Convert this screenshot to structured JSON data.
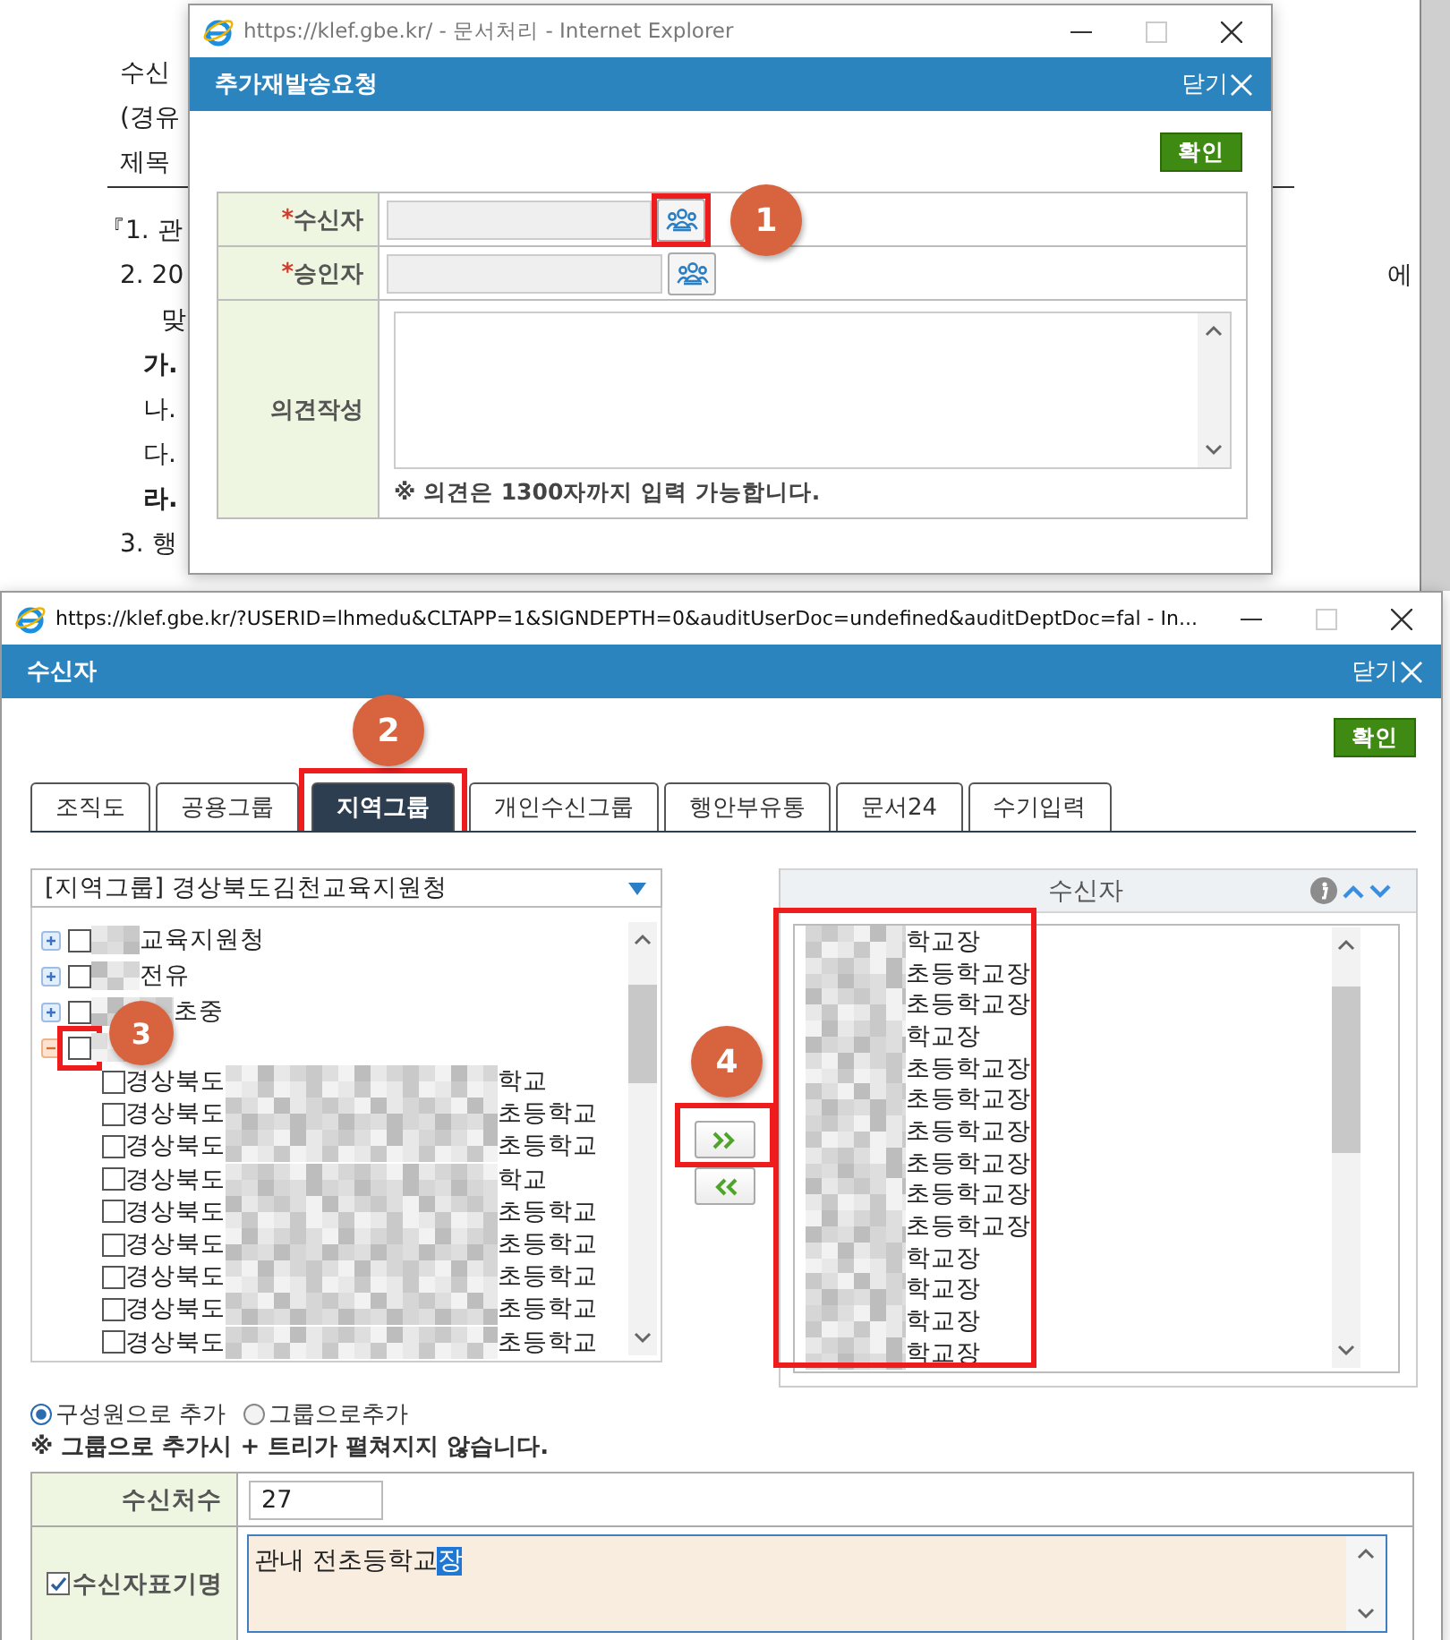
{
  "background_document": {
    "lines": [
      {
        "text": "수신",
        "kind": "head"
      },
      {
        "text": "(경유",
        "kind": "head"
      },
      {
        "text": "제목",
        "kind": "subject"
      },
      {
        "text": "『1. 관",
        "kind": "para"
      },
      {
        "text": "2. 20",
        "kind": "head",
        "end_text": "에"
      },
      {
        "text": "맞",
        "kind": "cont"
      },
      {
        "text": "가.",
        "kind": "sub",
        "bold": true
      },
      {
        "text": "나.",
        "kind": "sub"
      },
      {
        "text": "다.",
        "kind": "sub"
      },
      {
        "text": "라.",
        "kind": "sub",
        "bold": true
      },
      {
        "text": "3. 행",
        "kind": "head"
      }
    ]
  },
  "popup": {
    "window_title": "https://klef.gbe.kr/ - 문서처리 - Internet Explorer",
    "header": "추가재발송요청",
    "close_label": "닫기",
    "confirm_button": "확인",
    "fields": [
      {
        "kind": "picker",
        "label": "수신자",
        "required_mark": "*",
        "highlighted": true
      },
      {
        "kind": "picker",
        "label": "승인자",
        "required_mark": "*",
        "highlighted": false
      },
      {
        "kind": "textarea",
        "label": "의견작성",
        "note": "※ 의견은 1300자까지 입력 가능합니다."
      }
    ],
    "annotations": [
      {
        "number": "1"
      }
    ]
  },
  "recipient_window": {
    "window_title": "https://klef.gbe.kr/?USERID=lhmedu&CLTAPP=1&SIGNDEPTH=0&auditUserDoc=undefined&auditDeptDoc=fal - In...",
    "header": "수신자",
    "close_label": "닫기",
    "confirm_button": "확인",
    "tabs": [
      {
        "label": "조직도",
        "selected": false,
        "highlighted": false
      },
      {
        "label": "공용그룹",
        "selected": false,
        "highlighted": false
      },
      {
        "label": "지역그룹",
        "selected": true,
        "highlighted": true
      },
      {
        "label": "개인수신그룹",
        "selected": false,
        "highlighted": false
      },
      {
        "label": "행안부유통",
        "selected": false,
        "highlighted": false
      },
      {
        "label": "문서24",
        "selected": false,
        "highlighted": false
      },
      {
        "label": "수기입력",
        "selected": false,
        "highlighted": false
      }
    ],
    "group_select": "[지역그룹] 경상북도김천교육지원청",
    "tree": [
      {
        "redacted": true,
        "suffix": "교육지원청",
        "expanded": false,
        "checked": false,
        "highlighted": false
      },
      {
        "redacted": true,
        "suffix": "전유",
        "expanded": false,
        "checked": false,
        "highlighted": false
      },
      {
        "redacted": true,
        "suffix": "초중",
        "expanded": false,
        "checked": false,
        "highlighted": false
      },
      {
        "redacted": true,
        "expanded": true,
        "checked": false,
        "highlighted": true,
        "children": [
          {
            "prefix": "경상북도",
            "redacted": true,
            "suffix": "학교",
            "checked": false
          },
          {
            "prefix": "경상북도",
            "redacted": true,
            "suffix": "초등학교",
            "checked": false
          },
          {
            "prefix": "경상북도",
            "redacted": true,
            "suffix": "초등학교",
            "checked": false
          },
          {
            "prefix": "경상북도",
            "redacted": true,
            "suffix": "학교",
            "checked": false
          },
          {
            "prefix": "경상북도",
            "redacted": true,
            "suffix": "초등학교",
            "checked": false
          },
          {
            "prefix": "경상북도",
            "redacted": true,
            "suffix": "초등학교",
            "checked": false
          },
          {
            "prefix": "경상북도",
            "redacted": true,
            "suffix": "초등학교",
            "checked": false
          },
          {
            "prefix": "경상북도",
            "redacted": true,
            "suffix": "초등학교",
            "checked": false
          },
          {
            "prefix": "경상북도",
            "redacted": true,
            "suffix": "초등학교",
            "checked": false
          }
        ]
      }
    ],
    "move_buttons": [
      {
        "kind": "add",
        "highlighted": true
      },
      {
        "kind": "remove",
        "highlighted": false
      }
    ],
    "recipients_header": "수신자",
    "recipients_highlighted": true,
    "recipients": [
      {
        "redacted": true,
        "suffix": "학교장"
      },
      {
        "redacted": true,
        "suffix": "초등학교장"
      },
      {
        "redacted": true,
        "suffix": "초등학교장"
      },
      {
        "redacted": true,
        "suffix": "학교장"
      },
      {
        "redacted": true,
        "suffix": "초등학교장"
      },
      {
        "redacted": true,
        "suffix": "초등학교장"
      },
      {
        "redacted": true,
        "suffix": "초등학교장"
      },
      {
        "redacted": true,
        "suffix": "초등학교장"
      },
      {
        "redacted": true,
        "suffix": "초등학교장"
      },
      {
        "redacted": true,
        "suffix": "초등학교장"
      },
      {
        "redacted": true,
        "suffix": "학교장"
      },
      {
        "redacted": true,
        "suffix": "학교장"
      },
      {
        "redacted": true,
        "suffix": "학교장"
      },
      {
        "redacted": true,
        "suffix": "학교장"
      }
    ],
    "add_modes": [
      {
        "label": "구성원으로 추가",
        "selected": true
      },
      {
        "label": "그룹으로추가",
        "selected": false
      }
    ],
    "add_note": "※ 그룹으로 추가시 + 트리가 펼쳐지지 않습니다.",
    "count_label": "수신처수",
    "count_value": "27",
    "display_name": {
      "label": "수신자표기명",
      "checked": true,
      "text": "관내 전초등학교",
      "selected_text": "장"
    },
    "annotations": [
      {
        "number": "2"
      },
      {
        "number": "3"
      },
      {
        "number": "4"
      }
    ]
  }
}
